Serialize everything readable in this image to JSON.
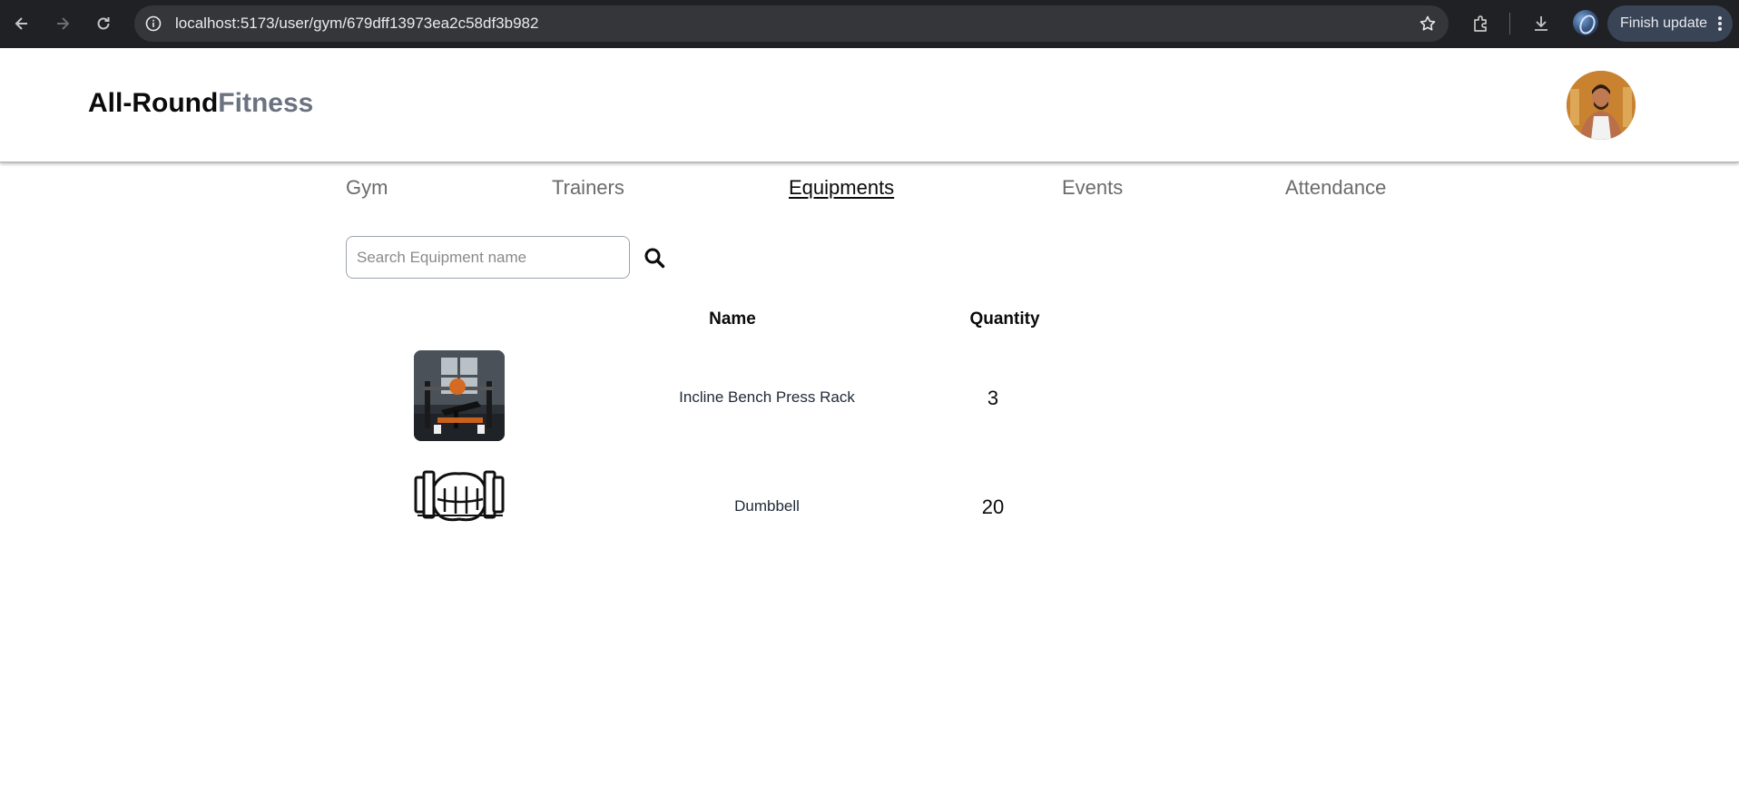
{
  "browser": {
    "url": "localhost:5173/user/gym/679dff13973ea2c58df3b982",
    "finish_update_label": "Finish update"
  },
  "brand": {
    "part1": "All-Round",
    "part2": "Fitness"
  },
  "tabs": [
    {
      "label": "Gym",
      "active": false
    },
    {
      "label": "Trainers",
      "active": false
    },
    {
      "label": "Equipments",
      "active": true
    },
    {
      "label": "Events",
      "active": false
    },
    {
      "label": "Attendance",
      "active": false
    }
  ],
  "search": {
    "placeholder": "Search Equipment name",
    "value": ""
  },
  "table": {
    "headers": {
      "name": "Name",
      "quantity": "Quantity"
    },
    "rows": [
      {
        "name": "Incline Bench Press Rack",
        "quantity": "3"
      },
      {
        "name": "Dumbbell",
        "quantity": "20"
      }
    ]
  }
}
